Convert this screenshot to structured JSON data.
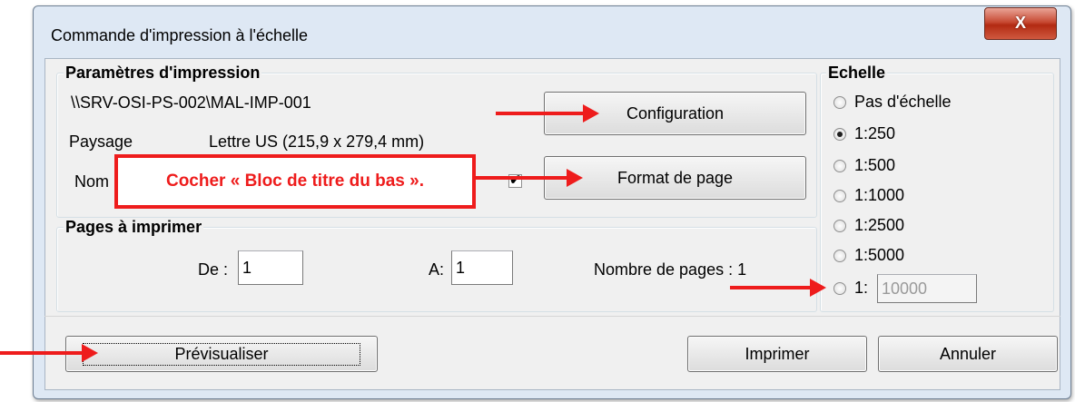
{
  "window": {
    "title": "Commande d'impression à l'échelle",
    "close_symbol": "X"
  },
  "print_params": {
    "legend": "Paramètres d'impression",
    "printer": "\\\\SRV-OSI-PS-002\\MAL-IMP-001",
    "orientation": "Paysage",
    "paper": "Lettre US (215,9 x 279,4 mm)",
    "name_label_partial": "Nom",
    "checkbox_mark": "✔",
    "configuration_button": "Configuration",
    "page_format_button": "Format de page"
  },
  "pages": {
    "legend": "Pages à imprimer",
    "from_label": "De :",
    "from_value": "1",
    "to_label": "A:",
    "to_value": "1",
    "count_text": "Nombre de pages : 1"
  },
  "scale": {
    "legend": "Echelle",
    "options": [
      "Pas d'échelle",
      "1:250",
      "1:500",
      "1:1000",
      "1:2500",
      "1:5000"
    ],
    "selected_index": 1,
    "custom_prefix": "1:",
    "custom_value": "10000"
  },
  "footer": {
    "preview_button": "Prévisualiser",
    "print_button": "Imprimer",
    "cancel_button": "Annuler"
  },
  "annotation": {
    "callout_text": "Cocher « Bloc de titre du bas ».",
    "color": "#ee1c1c"
  }
}
